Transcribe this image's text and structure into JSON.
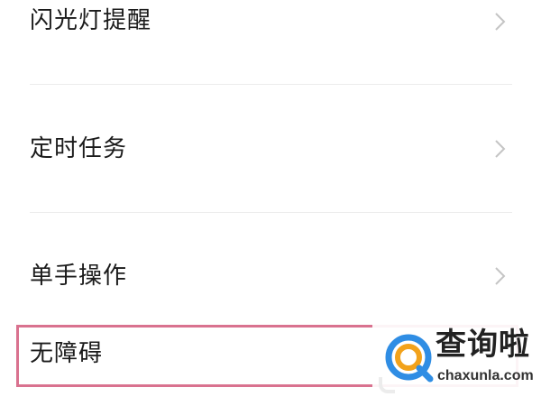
{
  "settings": {
    "items": [
      {
        "label": "闪光灯提醒",
        "icon": "chevron-right-icon"
      },
      {
        "label": "定时任务",
        "icon": "chevron-right-icon"
      },
      {
        "label": "单手操作",
        "icon": "chevron-right-icon"
      },
      {
        "label": "无障碍",
        "icon": "chevron-right-icon"
      }
    ]
  },
  "watermark": {
    "title": "查询啦",
    "url": "chaxunla.com",
    "icon": "magnifier-logo-icon"
  },
  "colors": {
    "background": "#ffffff",
    "text": "#1b1b1b",
    "divider": "#ececec",
    "chevron": "#c4c4c4",
    "highlight": "#d9728f",
    "logo_blue": "#2f8de4",
    "logo_orange": "#f2a21b"
  }
}
